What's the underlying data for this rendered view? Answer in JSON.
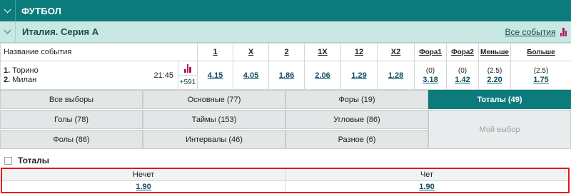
{
  "sport_header": {
    "title": "ФУТБОЛ"
  },
  "league_header": {
    "title": "Италия. Серия А",
    "all_events": "Все события"
  },
  "table": {
    "name_header": "Название события",
    "headers": [
      "1",
      "X",
      "2",
      "1X",
      "12",
      "X2",
      "Фора1",
      "Фора2",
      "Меньше",
      "Больше"
    ],
    "event": {
      "team1_num": "1.",
      "team1": "Торино",
      "team2_num": "2.",
      "team2": "Милан",
      "time": "21:45",
      "more_markets": "+591",
      "odds": [
        "4.15",
        "4.05",
        "1.86",
        "2.06",
        "1.29",
        "1.28",
        "3.18",
        "1.42",
        "2.20",
        "1.75"
      ],
      "params": [
        "(0)",
        "(0)",
        "(2.5)",
        "(2.5)"
      ]
    }
  },
  "tabs": {
    "all": "Все выборы",
    "main": "Основные (77)",
    "handicaps": "Форы (19)",
    "totals": "Тоталы (49)",
    "goals": "Голы (78)",
    "halves": "Таймы (153)",
    "corners": "Угловые (86)",
    "fouls": "Фолы (86)",
    "intervals": "Интервалы (46)",
    "misc": "Разное (6)",
    "my_choice": "Мой выбор"
  },
  "totals_section": {
    "title": "Тоталы",
    "odd_label": "Нечет",
    "odd_value": "1.90",
    "even_label": "Чет",
    "even_value": "1.90"
  },
  "colors": {
    "primary": "#0c7b7b",
    "league_bg": "#c9e8e3",
    "highlight": "#e5141d",
    "stats_icon": "#b2185b"
  }
}
